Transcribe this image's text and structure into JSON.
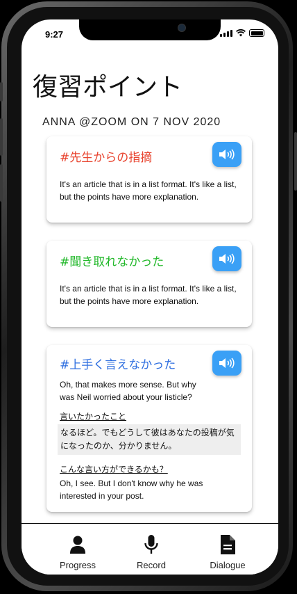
{
  "status_bar": {
    "time": "9:27"
  },
  "header": {
    "title": "復習ポイント",
    "subtitle": "ANNA  @ZOOM ON 7 NOV 2020"
  },
  "cards": [
    {
      "title": "#先生からの指摘",
      "title_color": "#e8432e",
      "body": "It's an article that is in a list format. It's like a list, but the points have more explanation."
    },
    {
      "title": "#聞き取れなかった",
      "title_color": "#22b82a",
      "body": "It's an article that is in a list format. It's like a list, but the points have more explanation."
    },
    {
      "title": "#上手く言えなかった",
      "title_color": "#2f6fe0",
      "body": "Oh, that makes more sense. But why was Neil worried about your listicle?",
      "wanted_label": "言いたかったこと",
      "wanted_text": "なるほど。でもどうして彼はあなたの投稿が気になったのか、分かりません。",
      "suggestion_label": "こんな言い方ができるかも？",
      "suggestion_text": "Oh, I see. But I don't know why he was interested in your post."
    }
  ],
  "bottom_nav": {
    "items": [
      {
        "label": "Progress",
        "icon": "person-icon"
      },
      {
        "label": "Record",
        "icon": "microphone-icon"
      },
      {
        "label": "Dialogue",
        "icon": "document-icon"
      }
    ]
  },
  "colors": {
    "speaker_button": "#3aa0f6"
  }
}
